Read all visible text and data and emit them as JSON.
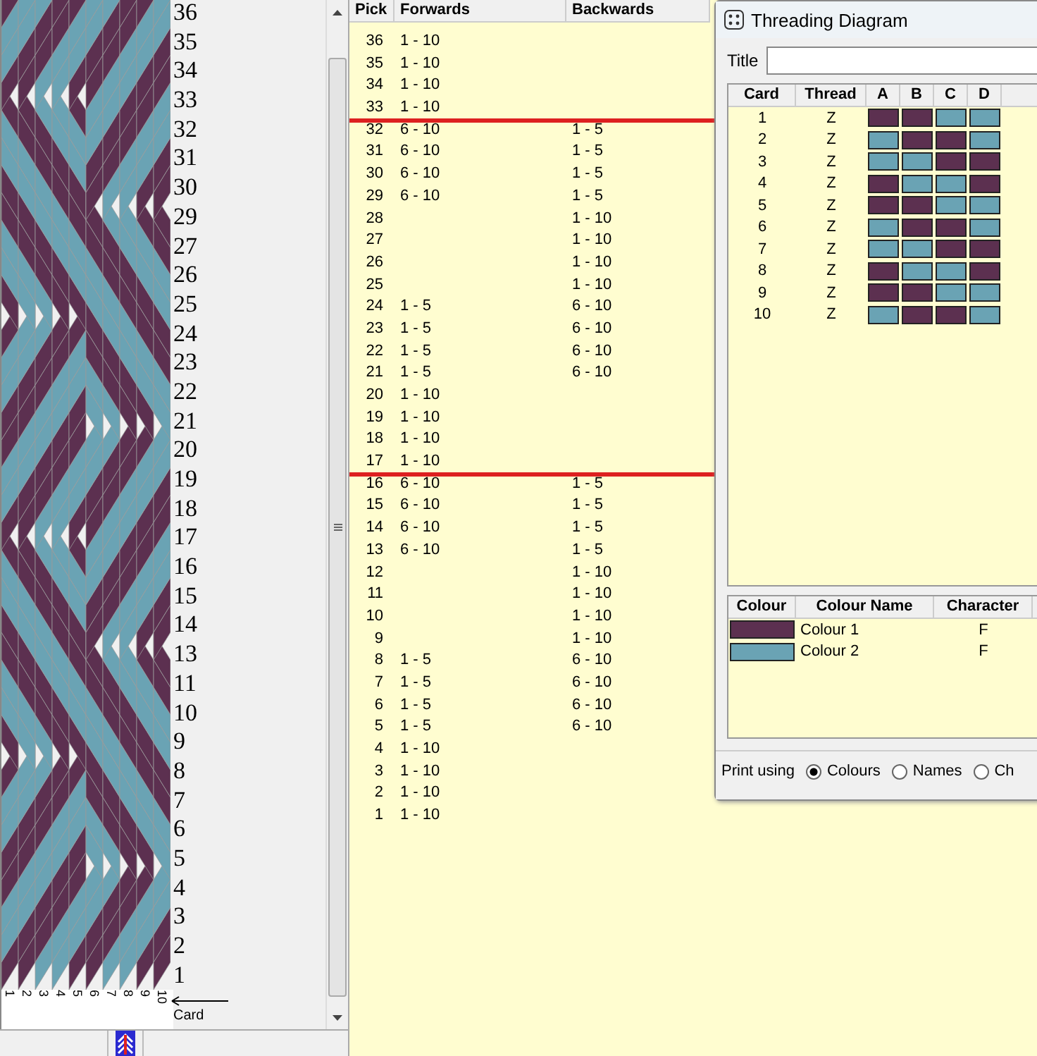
{
  "weave_panel": {
    "pick_labels": [
      "36",
      "35",
      "34",
      "33",
      "32",
      "31",
      "30",
      "29",
      "27",
      "26",
      "25",
      "24",
      "23",
      "22",
      "21",
      "20",
      "19",
      "18",
      "17",
      "16",
      "15",
      "14",
      "13",
      "11",
      "10",
      "9",
      "8",
      "7",
      "6",
      "5",
      "4",
      "3",
      "2",
      "1"
    ],
    "card_labels": [
      "1",
      "2",
      "3",
      "4",
      "5",
      "6",
      "7",
      "8",
      "9",
      "10"
    ],
    "axis_label": "Card"
  },
  "pick_list": {
    "columns": [
      "Pick",
      "Forwards",
      "Backwards"
    ],
    "rows": [
      {
        "pick": "36",
        "forwards": "1 - 10",
        "line_below": false
      },
      {
        "pick": "35",
        "forwards": "1 - 10",
        "line_below": false
      },
      {
        "pick": "34",
        "forwards": "1 - 10",
        "line_below": false
      },
      {
        "pick": "33",
        "forwards": "1 - 10",
        "line_below": true
      },
      {
        "pick": "32",
        "forwards": "6 - 10",
        "backwards": "1 - 5",
        "line_below": false
      },
      {
        "pick": "31",
        "forwards": "6 - 10",
        "backwards": "1 - 5",
        "line_below": false
      },
      {
        "pick": "30",
        "forwards": "6 - 10",
        "backwards": "1 - 5",
        "line_below": false
      },
      {
        "pick": "29",
        "forwards": "6 - 10",
        "backwards": "1 - 5",
        "line_below": false
      },
      {
        "pick": "28",
        "backwards": "1 - 10",
        "line_below": false
      },
      {
        "pick": "27",
        "backwards": "1 - 10",
        "line_below": false
      },
      {
        "pick": "26",
        "backwards": "1 - 10",
        "line_below": false
      },
      {
        "pick": "25",
        "backwards": "1 - 10",
        "line_below": false
      },
      {
        "pick": "24",
        "forwards": "1 - 5",
        "backwards": "6 - 10",
        "line_below": false
      },
      {
        "pick": "23",
        "forwards": "1 - 5",
        "backwards": "6 - 10",
        "line_below": false
      },
      {
        "pick": "22",
        "forwards": "1 - 5",
        "backwards": "6 - 10",
        "line_below": false
      },
      {
        "pick": "21",
        "forwards": "1 - 5",
        "backwards": "6 - 10",
        "line_below": false
      },
      {
        "pick": "20",
        "forwards": "1 - 10",
        "line_below": false
      },
      {
        "pick": "19",
        "forwards": "1 - 10",
        "line_below": false
      },
      {
        "pick": "18",
        "forwards": "1 - 10",
        "line_below": false
      },
      {
        "pick": "17",
        "forwards": "1 - 10",
        "line_below": true
      },
      {
        "pick": "16",
        "forwards": "6 - 10",
        "backwards": "1 - 5",
        "line_below": false
      },
      {
        "pick": "15",
        "forwards": "6 - 10",
        "backwards": "1 - 5",
        "line_below": false
      },
      {
        "pick": "14",
        "forwards": "6 - 10",
        "backwards": "1 - 5",
        "line_below": false
      },
      {
        "pick": "13",
        "forwards": "6 - 10",
        "backwards": "1 - 5",
        "line_below": false
      },
      {
        "pick": "12",
        "backwards": "1 - 10",
        "line_below": false
      },
      {
        "pick": "11",
        "backwards": "1 - 10",
        "line_below": false
      },
      {
        "pick": "10",
        "backwards": "1 - 10",
        "line_below": false
      },
      {
        "pick": "9",
        "backwards": "1 - 10",
        "line_below": false
      },
      {
        "pick": "8",
        "forwards": "1 - 5",
        "backwards": "6 - 10",
        "line_below": false
      },
      {
        "pick": "7",
        "forwards": "1 - 5",
        "backwards": "6 - 10",
        "line_below": false
      },
      {
        "pick": "6",
        "forwards": "1 - 5",
        "backwards": "6 - 10",
        "line_below": false
      },
      {
        "pick": "5",
        "forwards": "1 - 5",
        "backwards": "6 - 10",
        "line_below": false
      },
      {
        "pick": "4",
        "forwards": "1 - 10",
        "line_below": false
      },
      {
        "pick": "3",
        "forwards": "1 - 10",
        "line_below": false
      },
      {
        "pick": "2",
        "forwards": "1 - 10",
        "line_below": false
      },
      {
        "pick": "1",
        "forwards": "1 - 10",
        "line_below": false
      }
    ]
  },
  "dialog": {
    "title": "Threading Diagram",
    "title_label": "Title",
    "card_table": {
      "columns": [
        "Card",
        "Thread",
        "A",
        "B",
        "C",
        "D"
      ],
      "rows": [
        {
          "card": "1",
          "thread": "Z",
          "holes": [
            {
              "color": "#5c3050"
            },
            {
              "color": "#5c3050"
            },
            {
              "color": "#6aa3b4"
            },
            {
              "color": "#6aa3b4"
            }
          ]
        },
        {
          "card": "2",
          "thread": "Z",
          "holes": [
            {
              "color": "#6aa3b4"
            },
            {
              "color": "#5c3050"
            },
            {
              "color": "#5c3050"
            },
            {
              "color": "#6aa3b4"
            }
          ]
        },
        {
          "card": "3",
          "thread": "Z",
          "holes": [
            {
              "color": "#6aa3b4"
            },
            {
              "color": "#6aa3b4"
            },
            {
              "color": "#5c3050"
            },
            {
              "color": "#5c3050"
            }
          ]
        },
        {
          "card": "4",
          "thread": "Z",
          "holes": [
            {
              "color": "#5c3050"
            },
            {
              "color": "#6aa3b4"
            },
            {
              "color": "#6aa3b4"
            },
            {
              "color": "#5c3050"
            }
          ]
        },
        {
          "card": "5",
          "thread": "Z",
          "holes": [
            {
              "color": "#5c3050"
            },
            {
              "color": "#5c3050"
            },
            {
              "color": "#6aa3b4"
            },
            {
              "color": "#6aa3b4"
            }
          ]
        },
        {
          "card": "6",
          "thread": "Z",
          "holes": [
            {
              "color": "#6aa3b4"
            },
            {
              "color": "#5c3050"
            },
            {
              "color": "#5c3050"
            },
            {
              "color": "#6aa3b4"
            }
          ]
        },
        {
          "card": "7",
          "thread": "Z",
          "holes": [
            {
              "color": "#6aa3b4"
            },
            {
              "color": "#6aa3b4"
            },
            {
              "color": "#5c3050"
            },
            {
              "color": "#5c3050"
            }
          ]
        },
        {
          "card": "8",
          "thread": "Z",
          "holes": [
            {
              "color": "#5c3050"
            },
            {
              "color": "#6aa3b4"
            },
            {
              "color": "#6aa3b4"
            },
            {
              "color": "#5c3050"
            }
          ]
        },
        {
          "card": "9",
          "thread": "Z",
          "holes": [
            {
              "color": "#5c3050"
            },
            {
              "color": "#5c3050"
            },
            {
              "color": "#6aa3b4"
            },
            {
              "color": "#6aa3b4"
            }
          ]
        },
        {
          "card": "10",
          "thread": "Z",
          "holes": [
            {
              "color": "#6aa3b4"
            },
            {
              "color": "#5c3050"
            },
            {
              "color": "#5c3050"
            },
            {
              "color": "#6aa3b4"
            }
          ]
        }
      ]
    },
    "colour_table": {
      "columns": [
        "Colour",
        "Colour Name",
        "Character"
      ],
      "rows": [
        {
          "color": "#5c3050",
          "name": "Colour 1",
          "character": "F"
        },
        {
          "color": "#6aa3b4",
          "name": "Colour 2",
          "character": "F"
        }
      ]
    },
    "print_using": {
      "label": "Print using",
      "options": [
        {
          "label": "Colours",
          "selected": true
        },
        {
          "label": "Names",
          "selected": false
        },
        {
          "label": "Ch",
          "selected": false
        }
      ]
    }
  }
}
